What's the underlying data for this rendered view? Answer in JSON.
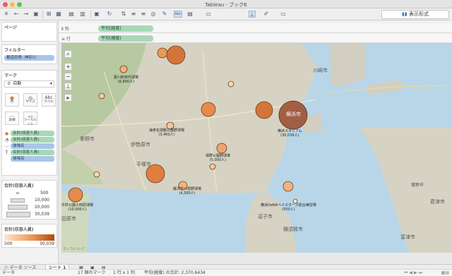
{
  "window": {
    "title": "Tableau - ブック6"
  },
  "toolbar": {
    "show_me": "表示形式"
  },
  "sidebar": {
    "pages_title": "ページ",
    "filters_title": "フィルター",
    "filter_pill": "都道府県: 神奈川",
    "marks_title": "マーク",
    "mark_type": "自動",
    "mark_buttons": [
      "色",
      "サイズ",
      "ラベル",
      "詳細",
      "ツールヒント"
    ],
    "mark_fields": [
      "合計(収容人員)",
      "合計(収容人員)",
      "球場名",
      "合計(収容人員)",
      "球場名"
    ],
    "size_legend_title": "合計(収容人員)",
    "size_legend_values": [
      "500",
      "10,000",
      "20,000",
      "30,039"
    ],
    "color_legend_title": "合計(収容人員)",
    "color_legend_min": "500",
    "color_legend_max": "30,039"
  },
  "shelves": {
    "columns_label": "列",
    "columns_pill": "平均(経度)",
    "rows_label": "行",
    "rows_pill": "平均(緯度)"
  },
  "map": {
    "attribution": "マップについて",
    "places": [
      "川崎市",
      "横浜市",
      "秦野市",
      "伊勢原市",
      "平塚市",
      "逗子市",
      "横須賀市",
      "富津市",
      "君津市",
      "田原市",
      "鷲野市"
    ],
    "stadiums": [
      {
        "name": "横浜スタジアム",
        "count": "(30,039人)"
      },
      {
        "name": "保野公園野球場",
        "count": "(5,000人)"
      },
      {
        "name": "藤沢市八部野球場",
        "count": "(4,300人)"
      },
      {
        "name": "海老名運動公園野球場",
        "count": "(3,400人)"
      },
      {
        "name": "愛川町田代球場",
        "count": "(6,800人)"
      },
      {
        "name": "中井公園小田原球場",
        "count": "(10,000人)"
      },
      {
        "name": "横浜DeNAベイスターズ総合練習場",
        "count": "(500人)"
      }
    ]
  },
  "tabs": {
    "datasource": "データ ソース",
    "sheet": "シート 1"
  },
  "status": {
    "source": "データ",
    "marks": "17 個のマーク",
    "rowcol": "1 行 x 1 列",
    "sum": "平均(経度) の合計: 2,370.6434"
  }
}
